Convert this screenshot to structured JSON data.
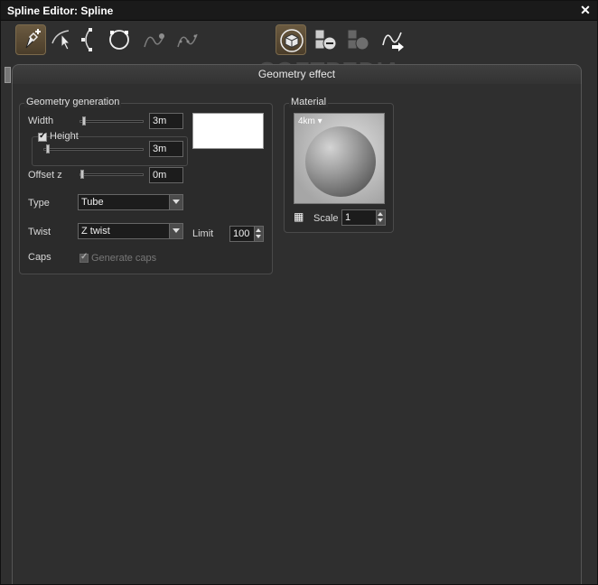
{
  "window": {
    "title": "Spline Editor: Spline",
    "close_glyph": "✕"
  },
  "toolbar": {
    "tools": [
      {
        "icon": "pen-add-icon",
        "active": true
      },
      {
        "icon": "select-arrow-icon",
        "active": false
      },
      {
        "icon": "node-edit-icon",
        "active": false
      },
      {
        "icon": "circle-spline-icon",
        "active": false
      },
      {
        "icon": "curve-point-icon",
        "active": false,
        "disabled": true
      },
      {
        "icon": "curve-dots-icon",
        "active": false,
        "disabled": true
      },
      {
        "icon": "geometry-cube-icon",
        "active": true
      },
      {
        "icon": "objects-remove-icon",
        "active": false
      },
      {
        "icon": "objects-add-icon",
        "active": false,
        "disabled": true
      },
      {
        "icon": "curve-export-icon",
        "active": false
      }
    ],
    "watermark": "SOFTPEDIA"
  },
  "tab": {
    "label": "Geometry effect"
  },
  "geometry": {
    "title": "Geometry generation",
    "width_label": "Width",
    "width_value": "3m",
    "width_slider": 0.05,
    "height_label": "Height",
    "height_checked": true,
    "height_value": "3m",
    "height_slider": 0.05,
    "offset_label": "Offset z",
    "offset_value": "0m",
    "offset_slider": 0.0,
    "type_label": "Type",
    "type_value": "Tube",
    "twist_label": "Twist",
    "twist_value": "Z twist",
    "limit_label": "Limit",
    "limit_value": "100",
    "caps_label": "Caps",
    "generate_caps_label": "Generate caps",
    "generate_caps_checked": true
  },
  "material": {
    "title": "Material",
    "tag": "4km",
    "scale_label": "Scale",
    "scale_value": "1"
  }
}
